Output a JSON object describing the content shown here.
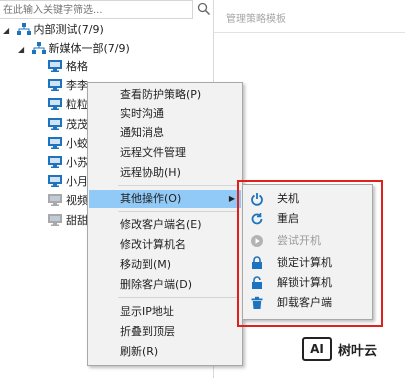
{
  "search": {
    "placeholder": "在此输入关键字筛选..."
  },
  "tree": {
    "root": {
      "label": "内部测试(7/9)"
    },
    "group": {
      "label": "新媒体一部(7/9)"
    },
    "clients": [
      {
        "label": "格格",
        "online": true
      },
      {
        "label": "李李",
        "online": true
      },
      {
        "label": "粒粒",
        "online": true
      },
      {
        "label": "茂茂",
        "online": true
      },
      {
        "label": "小蛟",
        "online": true
      },
      {
        "label": "小苏",
        "online": true
      },
      {
        "label": "小月",
        "online": true
      },
      {
        "label": "视频",
        "online": false
      },
      {
        "label": "甜甜",
        "online": false
      }
    ]
  },
  "right_panel": {
    "title": "管理策略模板"
  },
  "context_menu": {
    "items": [
      {
        "label": "查看防护策略(P)"
      },
      {
        "label": "实时沟通"
      },
      {
        "label": "通知消息"
      },
      {
        "label": "远程文件管理"
      },
      {
        "label": "远程协助(H)"
      },
      {
        "label": "其他操作(O)",
        "has_submenu": true,
        "active": true
      },
      {
        "label": "修改客户端名(E)"
      },
      {
        "label": "修改计算机名"
      },
      {
        "label": "移动到(M)"
      },
      {
        "label": "删除客户端(D)"
      },
      {
        "label": "显示IP地址"
      },
      {
        "label": "折叠到顶层"
      },
      {
        "label": "刷新(R)"
      }
    ]
  },
  "submenu": {
    "items": [
      {
        "label": "关机",
        "icon": "power-icon",
        "enabled": true
      },
      {
        "label": "重启",
        "icon": "restart-icon",
        "enabled": true
      },
      {
        "label": "尝试开机",
        "icon": "play-icon",
        "enabled": false
      },
      {
        "label": "锁定计算机",
        "icon": "lock-icon",
        "enabled": true
      },
      {
        "label": "解锁计算机",
        "icon": "unlock-icon",
        "enabled": true
      },
      {
        "label": "卸载客户端",
        "icon": "trash-icon",
        "enabled": true
      }
    ]
  },
  "colors": {
    "accent": "#1e73be",
    "highlight": "#91c9f7",
    "annotation_red": "#e0201b"
  },
  "watermark": {
    "logo": "AI",
    "text": "树叶云"
  }
}
